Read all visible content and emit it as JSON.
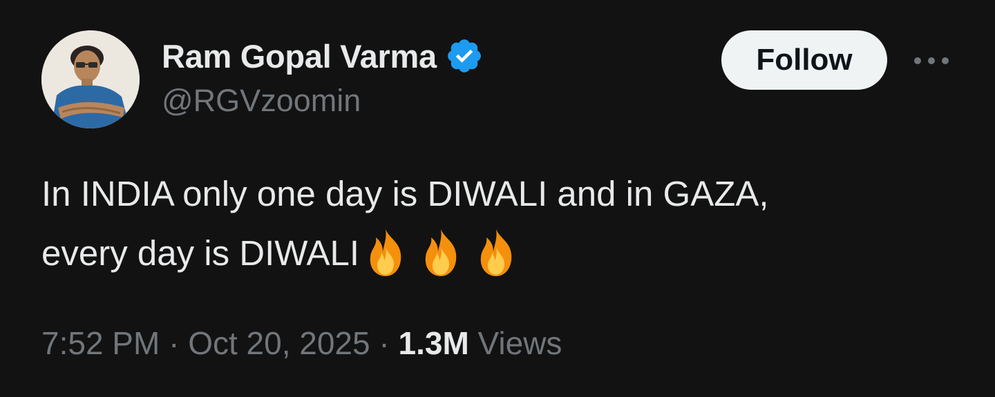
{
  "author": {
    "display_name": "Ram Gopal Varma",
    "handle": "@RGVzoomin",
    "verified": true,
    "verified_color": "#1d9bf0",
    "avatar_icon": "profile-photo"
  },
  "actions": {
    "follow_label": "Follow",
    "more_icon": "more-horizontal-icon"
  },
  "tweet": {
    "line1": "In INDIA only one day is DIWALI and in GAZA,",
    "line2": "every day is DIWALI",
    "emojis": [
      "🔥",
      "🔥",
      "🔥"
    ],
    "emoji_icon": "fire-emoji"
  },
  "meta": {
    "time": "7:52 PM",
    "separator": "·",
    "date": "Oct 20, 2025",
    "views_count": "1.3M",
    "views_label": "Views"
  },
  "colors": {
    "background": "#121212",
    "text_primary": "#e7e9ea",
    "text_secondary": "#71767b",
    "follow_bg": "#eff3f4"
  }
}
